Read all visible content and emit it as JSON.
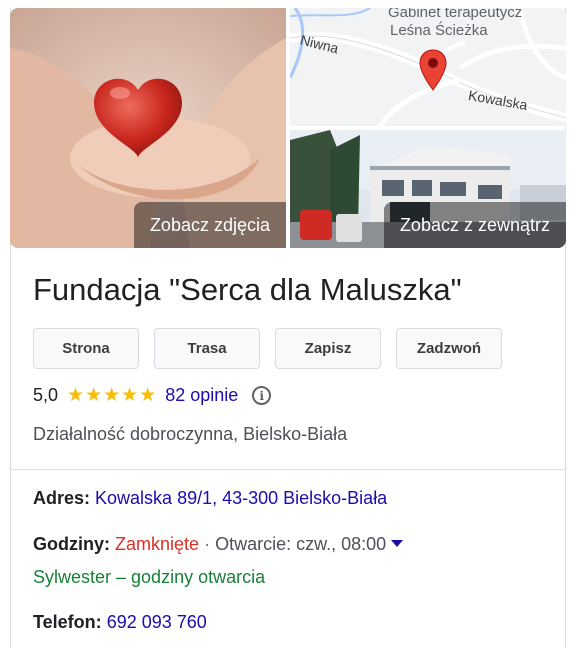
{
  "media": {
    "photos_button": "Zobacz zdjęcia",
    "outside_button": "Zobacz z zewnątrz",
    "map": {
      "place_label_line1": "Gabinet terapeutycz",
      "place_label_line2": "Leśna Ścieżka",
      "street_1": "Niwna",
      "street_2": "Kowalska"
    }
  },
  "business": {
    "name": "Fundacja \"Serca dla Maluszka\"",
    "actions": [
      "Strona",
      "Trasa",
      "Zapisz",
      "Zadzwoń"
    ],
    "rating": "5,0",
    "stars": "★★★★★",
    "reviews": "82 opinie",
    "category": "Działalność dobroczynna, Bielsko-Biała"
  },
  "details": {
    "address_label": "Adres:",
    "address_value": "Kowalska 89/1, 43-300 Bielsko-Biała",
    "hours_label": "Godziny:",
    "hours_status": "Zamknięte",
    "hours_separator": "·",
    "hours_next": "Otwarcie: czw., 08:00",
    "holiday_hours": "Sylwester – godziny otwarcia",
    "phone_label": "Telefon:",
    "phone_value": "692 093 760"
  },
  "colors": {
    "link": "#1a0dab",
    "closed": "#d93025",
    "holiday": "#188038",
    "star": "#fbbc04",
    "map_pin": "#ea4335"
  }
}
